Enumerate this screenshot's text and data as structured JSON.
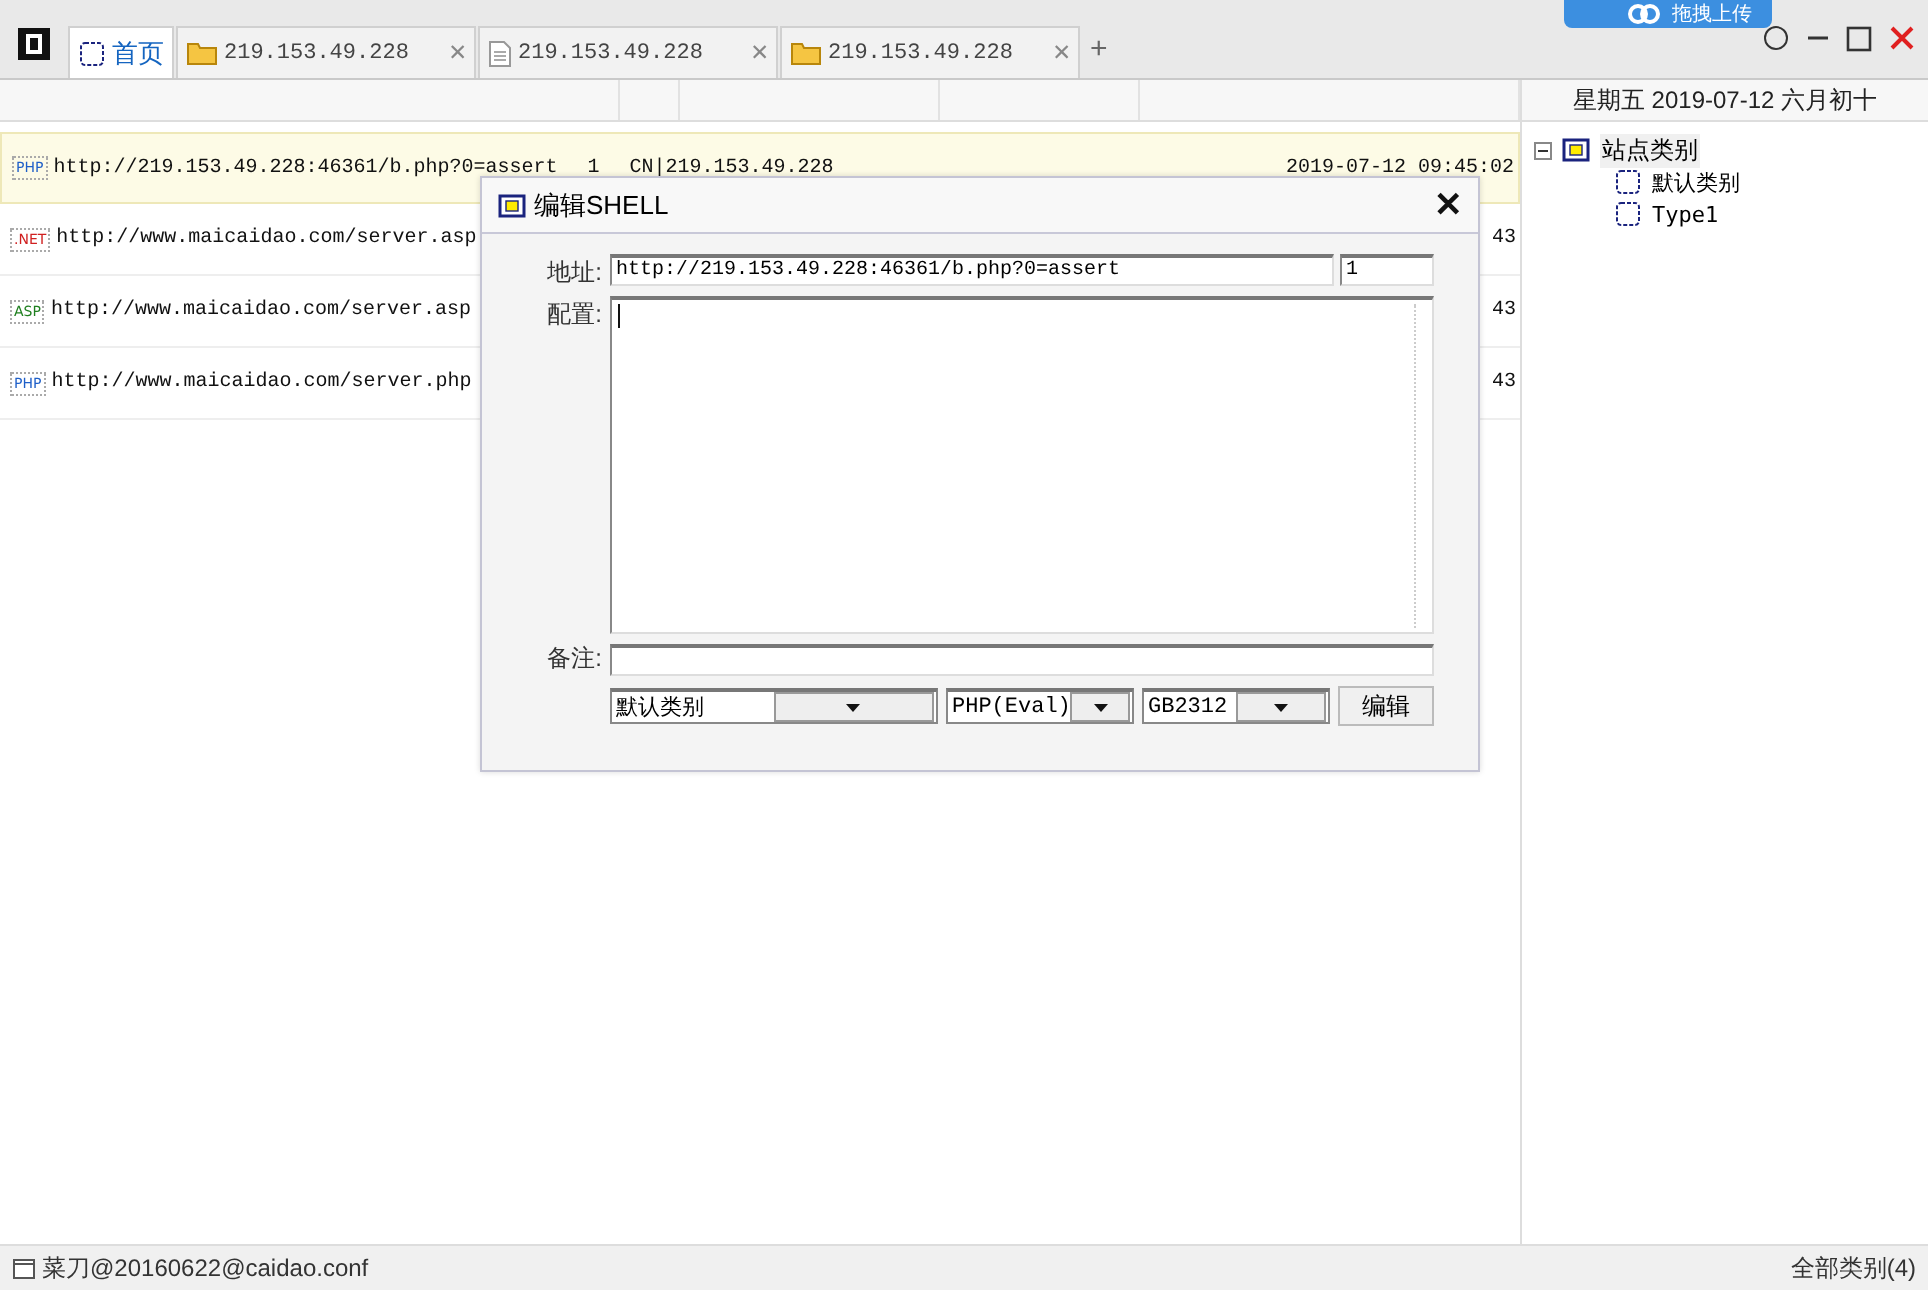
{
  "overlay_badge": {
    "label": "拖拽上传"
  },
  "tabs": [
    {
      "kind": "home",
      "label": "首页",
      "selected": true
    },
    {
      "kind": "folder",
      "label": "219.153.49.228",
      "selected": false,
      "close": "✕"
    },
    {
      "kind": "file",
      "label": "219.153.49.228",
      "selected": false,
      "close": "✕"
    },
    {
      "kind": "folder",
      "label": "219.153.49.228",
      "selected": false,
      "close": "✕"
    }
  ],
  "new_tab": "+",
  "date_header": "星期五 2019-07-12 六月初十",
  "rows": [
    {
      "type_badge": "PHP",
      "color": "#1e5fc8",
      "url": "http://219.153.49.228:46361/b.php?0=assert",
      "count": "1",
      "ip": "CN|219.153.49.228",
      "time": "2019-07-12 09:45:02",
      "selected": true
    },
    {
      "type_badge": ".NET",
      "color": "#d02020",
      "url": "http://www.maicaidao.com/server.asp",
      "time": "43",
      "selected": false
    },
    {
      "type_badge": "ASP",
      "color": "#208020",
      "url": "http://www.maicaidao.com/server.asp",
      "time": "43",
      "selected": false
    },
    {
      "type_badge": "PHP",
      "color": "#1e5fc8",
      "url": "http://www.maicaidao.com/server.php",
      "time": "43",
      "selected": false
    }
  ],
  "tree": [
    {
      "label": "站点类别",
      "expanded": true,
      "children": [
        {
          "label": "默认类别"
        },
        {
          "label": "Type1"
        }
      ]
    }
  ],
  "dialog": {
    "title": "编辑SHELL",
    "close": "✕",
    "address_label": "地址:",
    "address": "http://219.153.49.228:46361/b.php?0=assert",
    "password": "1",
    "config_label": "配置:",
    "note_label": "备注:",
    "category": "默认类别",
    "script_type": "PHP(Eval)",
    "encoding": "GB2312",
    "submit": "编辑"
  },
  "status_bar": {
    "config_file": "菜刀@20160622@caidao.conf",
    "category_count": "全部类别(4)"
  }
}
